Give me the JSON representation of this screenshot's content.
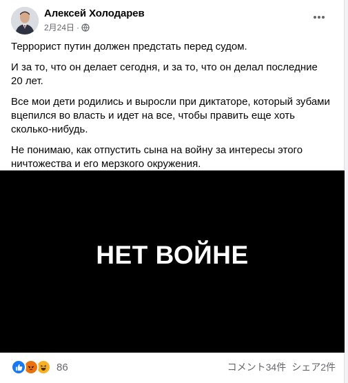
{
  "post": {
    "author": "Алексей Холодарев",
    "date": "2月24日",
    "separator": "·",
    "paragraphs": [
      "Террорист путин должен предстать перед судом.",
      "И за то, что он делает сегодня, и за то, что он делал последние 20 лет.",
      "Все мои дети родились и выросли при диктаторе, который зубами вцепился во власть и идет на все, чтобы править еще хоть сколько-нибудь.",
      "Не понимаю, как отпустить сына на войну за интересы этого ничтожества и его мерзкого окружения."
    ],
    "image_text": "НЕТ ВОЙНЕ"
  },
  "footer": {
    "reaction_count": "86",
    "comments": "コメント34件",
    "shares": "シェア2件"
  },
  "colors": {
    "like": "#1877f2",
    "angry": "#e9710f",
    "haha": "#f7b125",
    "muted": "#65676b"
  },
  "icons": {
    "globe": "globe-icon",
    "more": "more-options-icon",
    "like": "like-reaction-icon",
    "angry": "angry-reaction-icon",
    "haha": "haha-reaction-icon"
  }
}
